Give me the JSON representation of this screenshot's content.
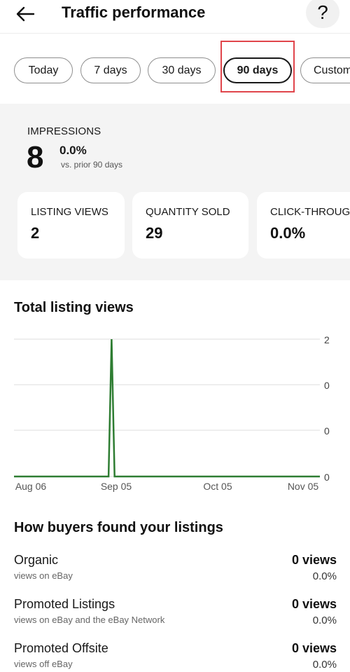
{
  "header": {
    "title": "Traffic performance",
    "help_label": "?"
  },
  "date_ranges": [
    {
      "label": "Today",
      "selected": false
    },
    {
      "label": "7 days",
      "selected": false
    },
    {
      "label": "30 days",
      "selected": false
    },
    {
      "label": "90 days",
      "selected": true
    },
    {
      "label": "Custom",
      "selected": false
    }
  ],
  "impressions": {
    "label": "IMPRESSIONS",
    "value": "8",
    "change": "0.0%",
    "comparison": "vs. prior 90 days"
  },
  "cards": [
    {
      "label": "LISTING VIEWS",
      "value": "2"
    },
    {
      "label": "QUANTITY SOLD",
      "value": "29"
    },
    {
      "label": "CLICK-THROUGH RATE",
      "value": "0.0%"
    }
  ],
  "chart_data": {
    "type": "line",
    "title": "Total listing views",
    "x_tick_labels": [
      "Aug 06",
      "Sep 05",
      "Oct 05",
      "Nov 05"
    ],
    "y_tick_labels": [
      "2",
      "0",
      "0",
      "0"
    ],
    "series": [
      {
        "color": "#2e7d32",
        "points": [
          {
            "x": "Aug 06",
            "y": 0
          },
          {
            "x": "Sep 01",
            "y": 0
          },
          {
            "x": "Sep 02",
            "y": 2
          },
          {
            "x": "Sep 03",
            "y": 0
          },
          {
            "x": "Nov 05",
            "y": 0
          }
        ]
      }
    ],
    "ylim": [
      0,
      2
    ],
    "grid": true
  },
  "sources": {
    "title": "How buyers found your listings",
    "items": [
      {
        "name": "Organic",
        "description": "views on eBay",
        "views": "0 views",
        "percent": "0.0%"
      },
      {
        "name": "Promoted Listings",
        "description": "views on eBay and the eBay Network",
        "views": "0 views",
        "percent": "0.0%"
      },
      {
        "name": "Promoted Offsite",
        "description": "views off eBay",
        "views": "0 views",
        "percent": "0.0%"
      }
    ]
  },
  "colors": {
    "line": "#2e7d32",
    "highlight": "#e0454b",
    "section_bg": "#f4f4f4"
  }
}
